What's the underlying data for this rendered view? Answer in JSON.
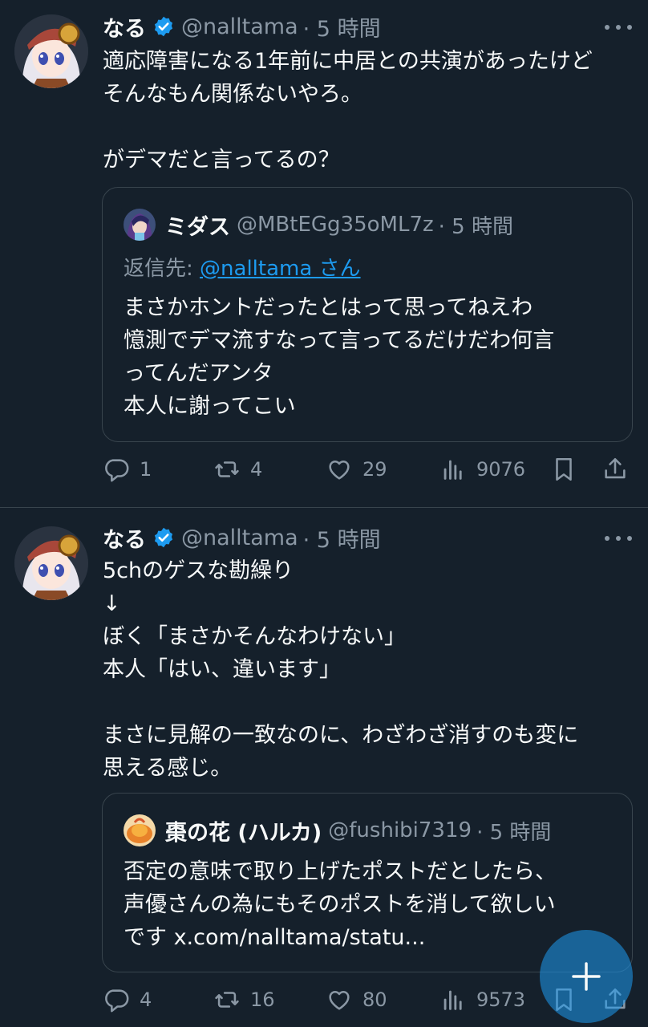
{
  "tweets": [
    {
      "author_name": "なる",
      "author_handle": "@nalltama",
      "time": "· 5 時間",
      "text_lines": [
        "適応障害になる1年前に中居との共演があったけど",
        "そんなもん関係ないやろ。",
        "",
        "がデマだと言ってるの？"
      ],
      "quote": {
        "author_name": "ミダス",
        "author_handle": "@MBtEGg35oML7z",
        "time": "· 5 時間",
        "reply_prefix": "返信先: ",
        "reply_link": "@nalltama さん",
        "text_lines": [
          "まさかホントだったとはって思ってねえわ",
          "憶測でデマ流すなって言ってるだけだわ何言",
          "ってんだアンタ",
          "本人に謝ってこい"
        ]
      },
      "stats": {
        "replies": "1",
        "reposts": "4",
        "likes": "29",
        "views": "9076"
      }
    },
    {
      "author_name": "なる",
      "author_handle": "@nalltama",
      "time": "· 5 時間",
      "text_lines": [
        "5chのゲスな勘繰り",
        "↓",
        "ぼく「まさかそんなわけない」",
        "本人「はい、違います」",
        "",
        "まさに見解の一致なのに、わざわざ消すのも変に",
        "思える感じ。"
      ],
      "quote": {
        "author_name": "棗の花 (ハルカ)",
        "author_handle": "@fushibi7319",
        "time": "· 5 時間",
        "text_lines": [
          "否定の意味で取り上げたポストだとしたら、",
          "声優さんの為にもそのポストを消して欲しい",
          "です x.com/nalltama/statu..."
        ]
      },
      "stats": {
        "replies": "4",
        "reposts": "16",
        "likes": "80",
        "views": "9573"
      }
    }
  ],
  "icons": {
    "verified": "verified-badge-icon",
    "reply": "reply-icon",
    "repost": "repost-icon",
    "like": "heart-icon",
    "views": "views-icon",
    "bookmark": "bookmark-icon",
    "share": "share-icon",
    "compose": "plus-icon"
  },
  "colors": {
    "background": "#15202b",
    "text": "#f7f9f9",
    "secondary": "#8b98a5",
    "accent": "#1d9bf0",
    "border": "#38444d"
  }
}
